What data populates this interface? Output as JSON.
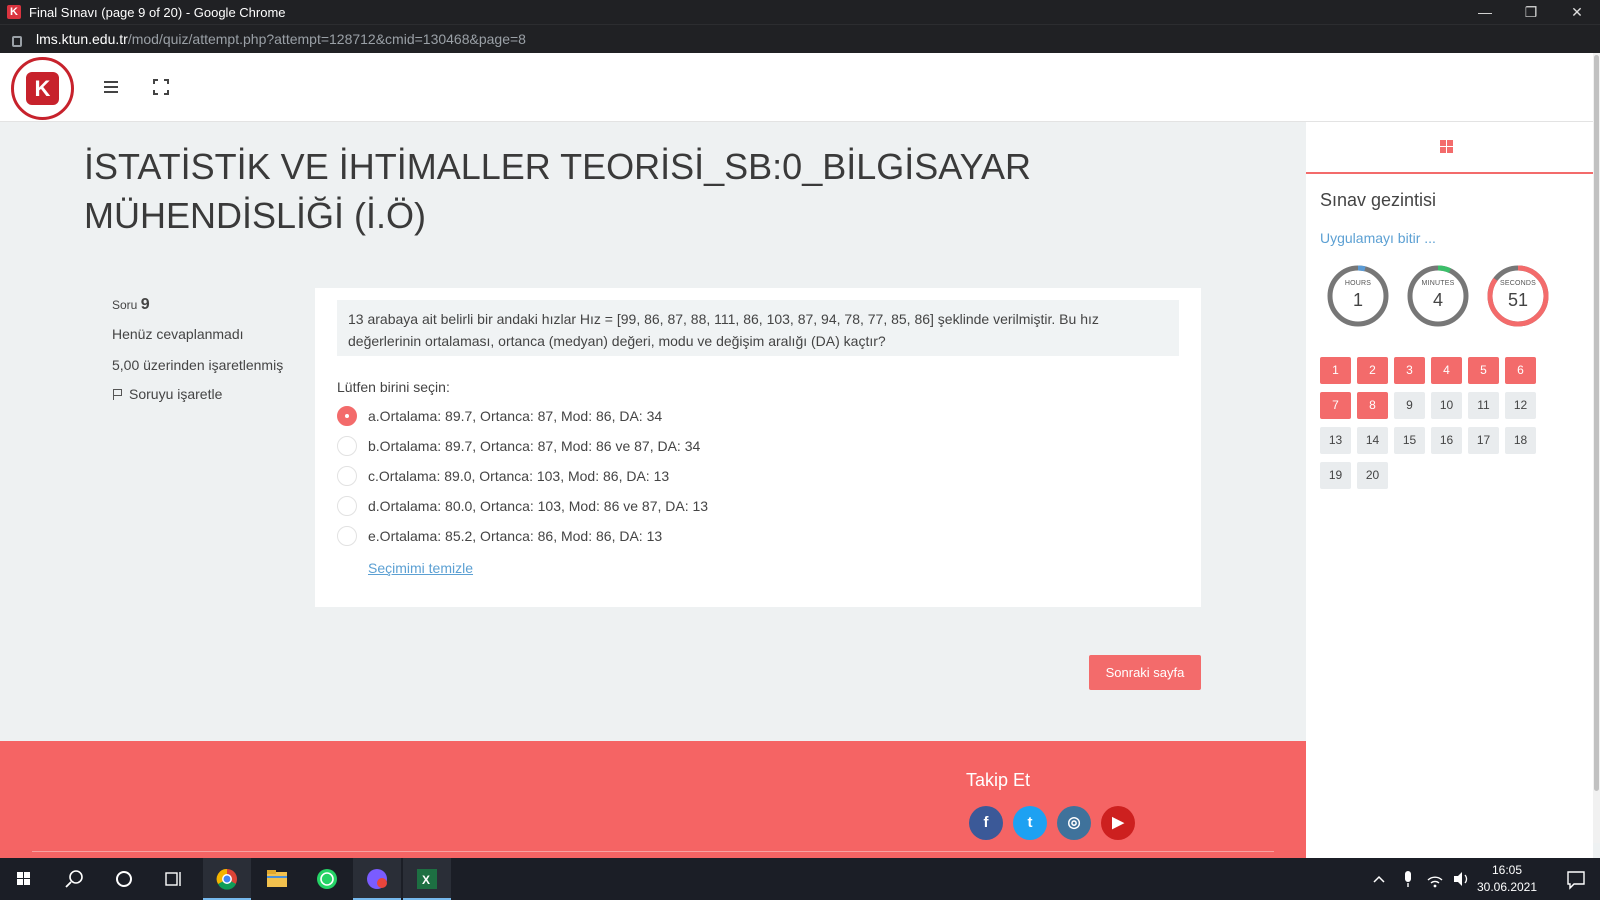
{
  "browser": {
    "window_title": "Final Sınavı (page 9 of 20) - Google Chrome",
    "url_host": "lms.ktun.edu.tr",
    "url_path": "/mod/quiz/attempt.php?attempt=128712&cmid=130468&page=8",
    "controls": [
      "—",
      "❐",
      "✕"
    ]
  },
  "page": {
    "title": "İSTATİSTİK VE İHTİMALLER TEORİSİ_SB:0_BİLGİSAYAR MÜHENDİSLİĞİ (İ.Ö)"
  },
  "question_info": {
    "label": "Soru",
    "number": "9",
    "state": "Henüz cevaplanmadı",
    "grade": "5,00 üzerinden işaretlenmiş",
    "flag": "Soruyu işaretle"
  },
  "question": {
    "text": "13 arabaya ait belirli bir andaki hızlar Hız = [99, 86, 87, 88, 111, 86, 103, 87, 94, 78, 77, 85, 86] şeklinde verilmiştir. Bu hız değerlerinin ortalaması, ortanca (medyan) değeri, modu ve değişim aralığı (DA) kaçtır?",
    "prompt": "Lütfen birini seçin:",
    "answers": [
      {
        "label": "a.Ortalama: 89.7, Ortanca: 87, Mod: 86, DA: 34",
        "checked": true
      },
      {
        "label": "b.Ortalama: 89.7, Ortanca: 87, Mod: 86 ve 87, DA: 34",
        "checked": false
      },
      {
        "label": "c.Ortalama: 89.0, Ortanca: 103, Mod: 86, DA: 13",
        "checked": false
      },
      {
        "label": "d.Ortalama: 80.0, Ortanca: 103, Mod: 86 ve 87, DA: 13",
        "checked": false
      },
      {
        "label": "e.Ortalama: 85.2, Ortanca: 86, Mod: 86, DA: 13",
        "checked": false
      }
    ],
    "clear_label": "Seçimimi temizle"
  },
  "next_button": "Sonraki sayfa",
  "drawer": {
    "title": "Sınav gezintisi",
    "finish_link": "Uygulamayı bitir ...",
    "timer": {
      "hours_label": "HOURS",
      "hours": "1",
      "hours_fraction": 0.04,
      "minutes_label": "MINUTES",
      "minutes": "4",
      "minutes_fraction": 0.07,
      "seconds_label": "SECONDS",
      "seconds": "51",
      "seconds_fraction": 0.85
    },
    "questions": [
      "1",
      "2",
      "3",
      "4",
      "5",
      "6",
      "7",
      "8",
      "9",
      "10",
      "11",
      "12",
      "13",
      "14",
      "15",
      "16",
      "17",
      "18",
      "19",
      "20"
    ],
    "answered_count": 8
  },
  "footer": {
    "follow_label": "Takip Et",
    "socials": [
      {
        "name": "facebook",
        "glyph": "f",
        "color": "#3b5998"
      },
      {
        "name": "twitter",
        "glyph": "t",
        "color": "#1da1f2"
      },
      {
        "name": "instagram",
        "glyph": "◎",
        "color": "#3f729b"
      },
      {
        "name": "youtube",
        "glyph": "▶",
        "color": "#cd201f"
      }
    ]
  },
  "taskbar": {
    "time": "16:05",
    "date": "30.06.2021"
  },
  "colors": {
    "accent": "#f36b6b",
    "link": "#5ca0d3",
    "timer_blue": "#5b9bd5",
    "timer_green": "#3cbf6a"
  }
}
